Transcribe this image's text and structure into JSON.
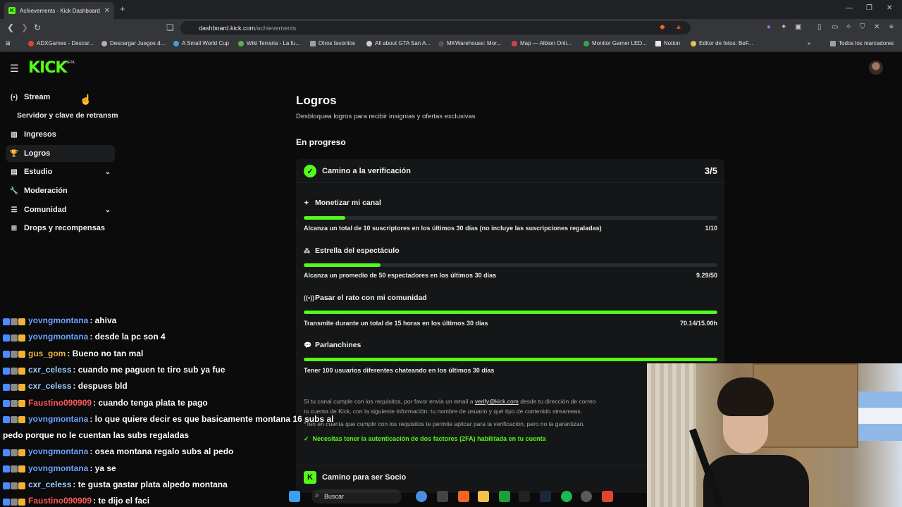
{
  "browser": {
    "tab_title": "Achievements - Kick Dashboard",
    "tab_favicon": "K",
    "tab_close": "✕",
    "new_tab": "+",
    "url_host": "dashboard.kick.com",
    "url_path": "/achievements",
    "bookmarks": [
      {
        "label": "ADXGames - Descar...",
        "color": "#e0452f"
      },
      {
        "label": "Descargar Juegos d...",
        "color": "#b0b0b0"
      },
      {
        "label": "A Small World Cup",
        "color": "#3aa0e0"
      },
      {
        "label": "Wiki Terraria - La fu...",
        "color": "#5bb04a"
      },
      {
        "label": "Otros favoritos",
        "color": "#9aa0a6"
      },
      {
        "label": "All about GTA San A...",
        "color": "#d0d0d0"
      },
      {
        "label": "MKWarehouse: Mor...",
        "color": "#222222"
      },
      {
        "label": "Map — Albion Onli...",
        "color": "#cc4444"
      },
      {
        "label": "Monitor Gamer LED...",
        "color": "#2ea84a"
      },
      {
        "label": "Notion",
        "color": "#e8e8e8"
      },
      {
        "label": "Editor de fotos: BeF...",
        "color": "#e2c24a"
      },
      {
        "label": "Todos los marcadores",
        "color": "#9aa0a6"
      }
    ]
  },
  "header": {
    "logo": "KICK",
    "beta": "BETA"
  },
  "sidebar": {
    "items": [
      {
        "label": "Stream",
        "icon": "(•)"
      },
      {
        "label": "Servidor y clave de retransm"
      },
      {
        "label": "Ingresos",
        "icon": "▥"
      },
      {
        "label": "Logros",
        "icon": "🏆"
      },
      {
        "label": "Estudio",
        "icon": "▤"
      },
      {
        "label": "Moderación",
        "icon": "🔧"
      },
      {
        "label": "Comunidad",
        "icon": "☰"
      },
      {
        "label": "Drops y recompensas",
        "icon": "⊞"
      }
    ]
  },
  "main": {
    "title": "Logros",
    "subtitle": "Desbloquea logros para recibir insignias y ofertas exclusivas",
    "section": "En progreso",
    "card": {
      "title": "Camino a la verificación",
      "count": "3/5",
      "tasks": [
        {
          "title": "Monetizar mi canal",
          "desc": "Alcanza un total de 10 suscriptores en los últimos 30 días (no incluye las suscripciones regaladas)",
          "value": "1/10",
          "progress": 0.1
        },
        {
          "title": "Estrella del espectáculo",
          "desc": "Alcanza un promedio de 50 espectadores en los últimos 30 días",
          "value": "9.29/50",
          "progress": 0.186
        },
        {
          "title": "Pasar el rato con mi comunidad",
          "desc": "Transmite durante un total de 15 horas en los últimos 30 días",
          "value": "70.14/15.00h",
          "progress": 1.0
        },
        {
          "title": "Parlanchines",
          "desc": "Tener 100 usuarios diferentes chateando en los últimos 30 días",
          "value": "",
          "progress": 1.0
        }
      ],
      "note_1a": "Si tu canal cumple con los requisitos, por favor envía un email a ",
      "note_link": "verify@kick.com",
      "note_1b": " desde tu dirección de correo",
      "note_2": "tu cuenta de Kick, con la siguiente información: tu nombre de usuario y qué tipo de contenido streameas.",
      "note_3": "*Ten en cuenta que cumplir con los requisitos te permite aplicar para la verificación, pero no la garantizan.",
      "check": "Necesitas tener la autenticación de dos factores (2FA) habilitada en tu cuenta"
    },
    "card2_title": "Camino para ser Socio"
  },
  "chat": [
    {
      "user": "yovngmontana",
      "color": "#6aa7ff",
      "msg": ": ahiva"
    },
    {
      "user": "yovngmontana",
      "color": "#6aa7ff",
      "msg": ": desde la pc son 4"
    },
    {
      "user": "gus_gom",
      "color": "#e8b04a",
      "msg": ": Bueno no tan mal"
    },
    {
      "user": "cxr_celess",
      "color": "#9fd0ff",
      "msg": ": cuando me paguen te tiro sub ya fue"
    },
    {
      "user": "cxr_celess",
      "color": "#9fd0ff",
      "msg": ": despues bld"
    },
    {
      "user": "Faustino090909",
      "color": "#ff5a5a",
      "msg": ": cuando tenga plata te pago"
    },
    {
      "user": "yovngmontana",
      "color": "#6aa7ff",
      "msg": ": lo que quiere decir es que basicamente montana 16 subs al"
    },
    {
      "user": "",
      "color": "#ffffff",
      "msg": "pedo porque no le cuentan las subs regaladas"
    },
    {
      "user": "yovngmontana",
      "color": "#6aa7ff",
      "msg": ": osea montana regalo subs al pedo"
    },
    {
      "user": "yovngmontana",
      "color": "#6aa7ff",
      "msg": ": ya se"
    },
    {
      "user": "cxr_celess",
      "color": "#9fd0ff",
      "msg": ": te gusta gastar plata alpedo montana"
    },
    {
      "user": "Faustino090909",
      "color": "#ff5a5a",
      "msg": ": te dijo el faci"
    }
  ],
  "taskbar": {
    "search": "Buscar"
  }
}
